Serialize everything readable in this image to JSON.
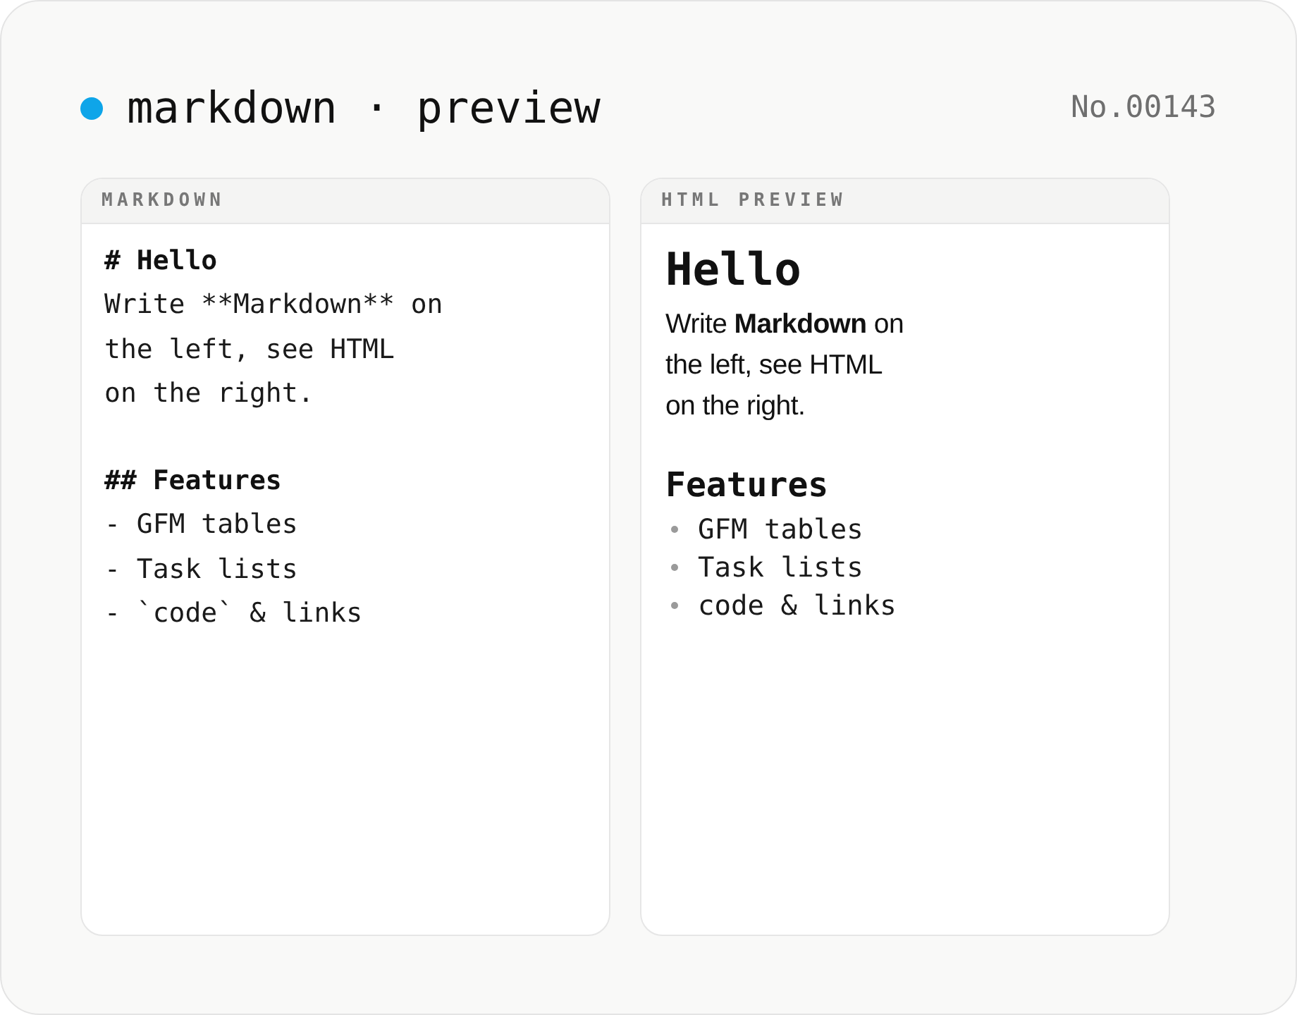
{
  "header": {
    "title": "markdown · preview",
    "number": "No.00143"
  },
  "panels": [
    {
      "kind": "source",
      "title": "MARKDOWN",
      "blocks": [
        {
          "lines": [
            {
              "kind": "heading",
              "text": "# Hello"
            },
            {
              "kind": "text",
              "text": "Write **Markdown** on"
            },
            {
              "kind": "text",
              "text": "the left, see HTML"
            },
            {
              "kind": "text",
              "text": "on the right."
            }
          ]
        },
        {
          "lines": [
            {
              "kind": "heading",
              "text": "## Features"
            },
            {
              "kind": "text",
              "text": "- GFM tables"
            },
            {
              "kind": "text",
              "text": "- Task lists"
            },
            {
              "kind": "text",
              "text": "- `code` & links"
            }
          ]
        }
      ]
    },
    {
      "kind": "preview",
      "title": "HTML PREVIEW",
      "blocks": [
        {
          "kind": "h1",
          "text": "Hello"
        },
        {
          "kind": "paragraph",
          "lines": [
            "Write **Markdown** on",
            "the left, see HTML",
            "on the right."
          ]
        },
        {
          "kind": "h2",
          "text": "Features"
        },
        {
          "kind": "list",
          "items": [
            "GFM tables",
            "Task lists",
            "code & links"
          ]
        }
      ]
    }
  ]
}
